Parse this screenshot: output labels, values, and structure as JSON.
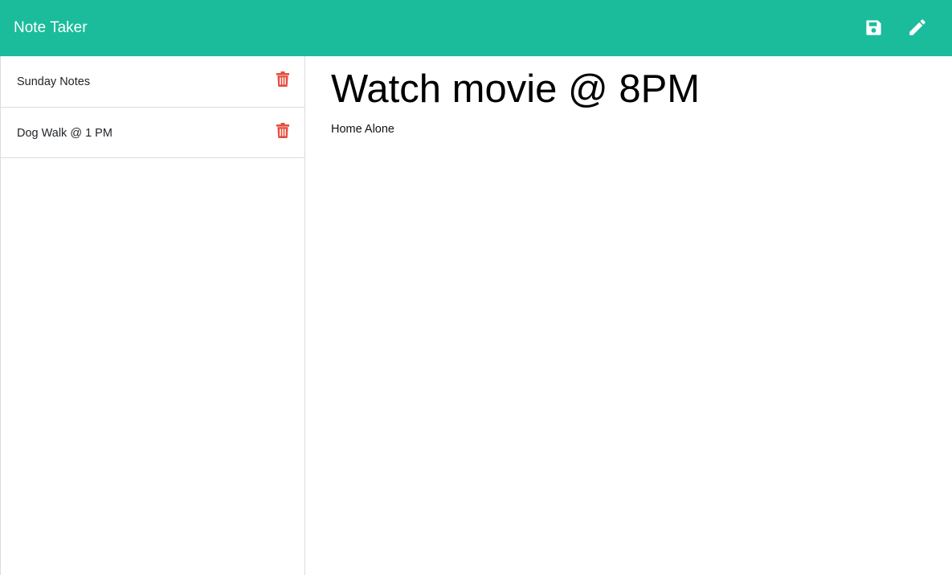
{
  "app": {
    "title": "Note Taker"
  },
  "toolbar": {
    "save_icon": "floppy-disk-icon",
    "edit_icon": "pencil-icon"
  },
  "notes": [
    {
      "title": "Sunday Notes",
      "delete_icon": "trash-icon"
    },
    {
      "title": "Dog Walk @ 1 PM",
      "delete_icon": "trash-icon"
    }
  ],
  "active_note": {
    "title": "Watch movie @ 8PM",
    "text": "Home Alone"
  },
  "colors": {
    "accent": "#1abc9c",
    "delete": "#e74c3c",
    "divider": "#dcdcdc"
  }
}
